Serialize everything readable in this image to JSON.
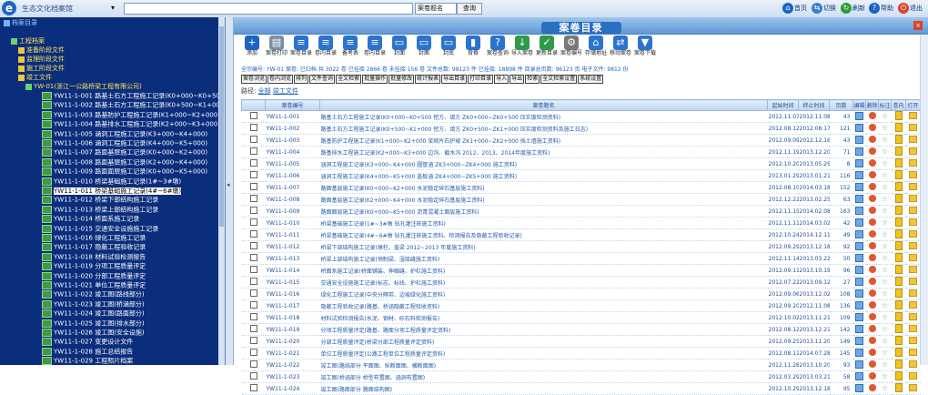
{
  "topbar": {
    "app_title": "生态文化档案馆",
    "module_select": "▾",
    "search_value": "",
    "scope_select": "案卷题名",
    "search_button": "查询",
    "buttons": [
      {
        "label": "首页",
        "icon": "home-icon",
        "color": "#1b63c4"
      },
      {
        "label": "切换",
        "icon": "switch-icon",
        "color": "#3d7bd0"
      },
      {
        "label": "刷新",
        "icon": "refresh-icon",
        "color": "#2a9a3a"
      },
      {
        "label": "帮助",
        "icon": "help-icon",
        "color": "#1b63c4"
      },
      {
        "label": "退出",
        "icon": "exit-icon",
        "color": "#d8452e"
      }
    ]
  },
  "tree": {
    "nodes": [
      {
        "label": "档案目录",
        "level": 0
      },
      {
        "label": "工程档案",
        "level": 1
      },
      {
        "label": "准备阶段文件",
        "level": 2
      },
      {
        "label": "监理阶段文件",
        "level": 2
      },
      {
        "label": "施工阶段文件",
        "level": 2
      },
      {
        "label": "竣工文件",
        "level": 2
      },
      {
        "label": "YW-01(浙江一公路桥梁工程有限公司)",
        "level": 3
      }
    ],
    "files": [
      "YW11-1-001 路基土石方工程施工记录(K0+000~K0+500)",
      "YW11-1-002 路基土石方工程施工记录(K0+500~K1+000)",
      "YW11-1-003 路基防护工程施工记录(K1+000~K2+000)",
      "YW11-1-004 路基排水工程施工记录(K2+000~K3+000)",
      "YW11-1-005 涵洞工程施工记录(K3+000~K4+000)",
      "YW11-1-006 涵洞工程施工记录(K4+000~K5+000)",
      "YW11-1-007 路面基层施工记录(K0+000~K2+000)",
      "YW11-1-008 路面基层施工记录(K2+000~K4+000)",
      "YW11-1-009 路面面层施工记录(K0+000~K5+000)",
      "YW11-1-010 桥梁基础施工记录(1#~3#墩)",
      "YW11-1-011 桥梁基础施工记录(4#~6#墩)",
      "YW11-1-012 桥梁下部结构施工记录",
      "YW11-1-013 桥梁上部结构施工记录",
      "YW11-1-014 桥面系施工记录",
      "YW11-1-015 交通安全设施施工记录",
      "YW11-1-016 绿化工程施工记录",
      "YW11-1-017 隐蔽工程验收记录",
      "YW11-1-018 材料试验检测报告",
      "YW11-1-019 分项工程质量评定",
      "YW11-1-020 分部工程质量评定",
      "YW11-1-021 单位工程质量评定",
      "YW11-1-022 竣工图(路线部分)",
      "YW11-1-023 竣工图(桥涵部分)",
      "YW11-1-024 竣工图(路面部分)",
      "YW11-1-025 竣工图(排水部分)",
      "YW11-1-026 竣工图(安全设施)",
      "YW11-1-027 变更设计文件",
      "YW11-1-028 施工总结报告",
      "YW11-1-029 工程照片档案"
    ]
  },
  "main": {
    "title": "案卷目录",
    "close": "×",
    "tools": [
      {
        "label": "添加",
        "icon": "add-icon",
        "color": "#1b63c4",
        "glyph": "+"
      },
      {
        "label": "案卷打印",
        "icon": "print-icon",
        "color": "#7a8fa8",
        "glyph": "▤"
      },
      {
        "label": "案卷目录",
        "icon": "catalog-icon",
        "color": "#2a74d0",
        "glyph": "≡"
      },
      {
        "label": "卷内目录",
        "icon": "inner-catalog-icon",
        "color": "#2a74d0",
        "glyph": "≡"
      },
      {
        "label": "备考表",
        "icon": "note-icon",
        "color": "#2a74d0",
        "glyph": "≡"
      },
      {
        "label": "卷内目录",
        "icon": "inner-list-icon",
        "color": "#2a74d0",
        "glyph": "≡"
      },
      {
        "label": "封面",
        "icon": "cover-icon",
        "color": "#2a74d0",
        "glyph": "▭"
      },
      {
        "label": "封面",
        "icon": "cover2-icon",
        "color": "#2a74d0",
        "glyph": "▭"
      },
      {
        "label": "封底",
        "icon": "back-cover-icon",
        "color": "#2a74d0",
        "glyph": "▭"
      },
      {
        "label": "背脊",
        "icon": "spine-icon",
        "color": "#2a74d0",
        "glyph": "▮"
      },
      {
        "label": "案卷查询",
        "icon": "query-icon",
        "color": "#2a74d0",
        "glyph": "?"
      },
      {
        "label": "导入案卷",
        "icon": "import-icon",
        "color": "#2f9a4a",
        "glyph": "↓"
      },
      {
        "label": "更新目录",
        "icon": "update-icon",
        "color": "#2f9a4a",
        "glyph": "✓"
      },
      {
        "label": "案卷编号",
        "icon": "settings-icon",
        "color": "#7a7a7a",
        "glyph": "⚙"
      },
      {
        "label": "存储地址",
        "icon": "storage-icon",
        "color": "#2a74d0",
        "glyph": "⌂"
      },
      {
        "label": "移动案卷",
        "icon": "move-icon",
        "color": "#2a74d0",
        "glyph": "⇄"
      },
      {
        "label": "案卷下载",
        "icon": "download-icon",
        "color": "#2a74d0",
        "glyph": "▼"
      }
    ],
    "info_line": "全宗编号: YW-01  案卷: 已归档 共 3022 卷  已挂接 2866 卷  未挂接 156 卷  文件总数: 98123 件  已挂接: 18898 件  目录总页数: 96123 页  电子文件: 9812 份",
    "modes": [
      "案卷浏览",
      "卷内浏览",
      "排列",
      "文件查询",
      "全文检索",
      "批量操作",
      "批量修改",
      "统计报表",
      "导出目录",
      "打印目录",
      "导入",
      "导出",
      "检索",
      "全文检索设置",
      "系统设置"
    ],
    "path_prefix": "路径:",
    "path_link1": "全部",
    "path_link2": "竣工文件",
    "columns": [
      "",
      "案卷编号",
      "案卷题名",
      "起始时间",
      "终止时间",
      "页数",
      "编辑",
      "删除",
      "标注",
      "卷内",
      "打开"
    ],
    "rows": [
      [
        "YW11-1-001",
        "路基土石方工程施工记录(K0+000~K0+500 挖方、填方 ZK0+000~ZK0+500 压实度检测资料)",
        "2012.11.07",
        "2012.11.08",
        "43"
      ],
      [
        "YW11-1-002",
        "路基土石方工程施工记录(K0+500~K1+000 挖方、填方 ZK0+500~ZK1+000 压实度检测资料及施工日志)",
        "2012.08.12",
        "2012.08.17",
        "121"
      ],
      [
        "YW11-1-003",
        "路基防护工程施工记录(K1+000~K2+000 浆砌片石护坡 ZK1+000~ZK2+000 挡土墙施工资料)",
        "2012.09.09",
        "2012.12.16",
        "43"
      ],
      [
        "YW11-1-004",
        "路基排水工程施工记录(K2+000~K3+000 边沟、截水沟 2012、2013、2014年度施工资料)",
        "2012.11.19",
        "2013.12.20",
        "71"
      ],
      [
        "YW11-1-005",
        "涵洞工程施工记录(K3+000~K4+000 圆管涵 ZK3+000~ZK4+000 施工资料)",
        "2012.10.20",
        "2013.05.25",
        "8"
      ],
      [
        "YW11-1-006",
        "涵洞工程施工记录(K4+000~K5+000 盖板涵 ZK4+000~ZK5+000 施工资料)",
        "2013.01.29",
        "2013.01.21",
        "116"
      ],
      [
        "YW11-1-007",
        "路面基层施工记录(K0+000~K2+000 水泥稳定碎石基层施工资料)",
        "2012.08.10",
        "2014.03.18",
        "152"
      ],
      [
        "YW11-1-008",
        "路面基层施工记录(K2+000~K4+000 水泥稳定碎石基层施工资料)",
        "2012.12.22",
        "2013.02.25",
        "63"
      ],
      [
        "YW11-1-009",
        "路面面层施工记录(K0+000~K5+000 沥青混凝土面层施工资料)",
        "2012.11.15",
        "2014.02.08",
        "163"
      ],
      [
        "YW11-1-010",
        "桥梁基础施工记录(1#~3#墩 钻孔灌注桩施工资料)",
        "2012.11.11",
        "2014.03.02",
        "42"
      ],
      [
        "YW11-1-011",
        "桥梁基础施工记录(4#~6#墩 钻孔灌注桩施工资料、检测报告及隐蔽工程验收记录)",
        "2012.10.24",
        "2014.12.11",
        "49"
      ],
      [
        "YW11-1-012",
        "桥梁下部结构施工记录(墩柱、盖梁 2012~2013 年度施工资料)",
        "2012.09.29",
        "2013.12.18",
        "92"
      ],
      [
        "YW11-1-013",
        "桥梁上部结构施工记录(预制梁、湿接缝施工资料)",
        "2012.11.14",
        "2013.03.22",
        "50"
      ],
      [
        "YW11-1-014",
        "桥面系施工记录(桥面铺装、伸缩缝、护栏施工资料)",
        "2012.09.11",
        "2013.10.19",
        "96"
      ],
      [
        "YW11-1-015",
        "交通安全设施施工记录(标志、标线、护栏施工资料)",
        "2012.07.22",
        "2013.09.12",
        "27"
      ],
      [
        "YW11-1-016",
        "绿化工程施工记录(中央分隔带、边坡绿化施工资料)",
        "2012.09.06",
        "2013.12.02",
        "108"
      ],
      [
        "YW11-1-017",
        "隐蔽工程验收记录(路基、桥涵隐蔽工程验收资料)",
        "2012.09.20",
        "2012.11.08",
        "136"
      ],
      [
        "YW11-1-018",
        "材料试验检测报告(水泥、钢材、砂石料检测报告)",
        "2012.10.02",
        "2013.11.21",
        "109"
      ],
      [
        "YW11-1-019",
        "分项工程质量评定(路基、路面分项工程质量评定资料)",
        "2012.08.12",
        "2013.12.21",
        "142"
      ],
      [
        "YW11-1-020",
        "分部工程质量评定(桥梁分部工程质量评定资料)",
        "2012.09.25",
        "2013.11.20",
        "149"
      ],
      [
        "YW11-1-021",
        "单位工程质量评定(公路工程单位工程质量评定资料)",
        "2012.08.11",
        "2014.07.28",
        "145"
      ],
      [
        "YW11-1-022",
        "竣工图(路线部分 平面图、纵断面图、横断面图)",
        "2012.11.28",
        "2013.10.20",
        "93"
      ],
      [
        "YW11-1-023",
        "竣工图(桥涵部分 桥型布置图、涵洞布置图)",
        "2012.03.29",
        "2013.03.21",
        "58"
      ],
      [
        "YW11-1-024",
        "竣工图(路面部分 路面结构图)",
        "2012.10.29",
        "2013.12.18",
        "95"
      ]
    ]
  }
}
